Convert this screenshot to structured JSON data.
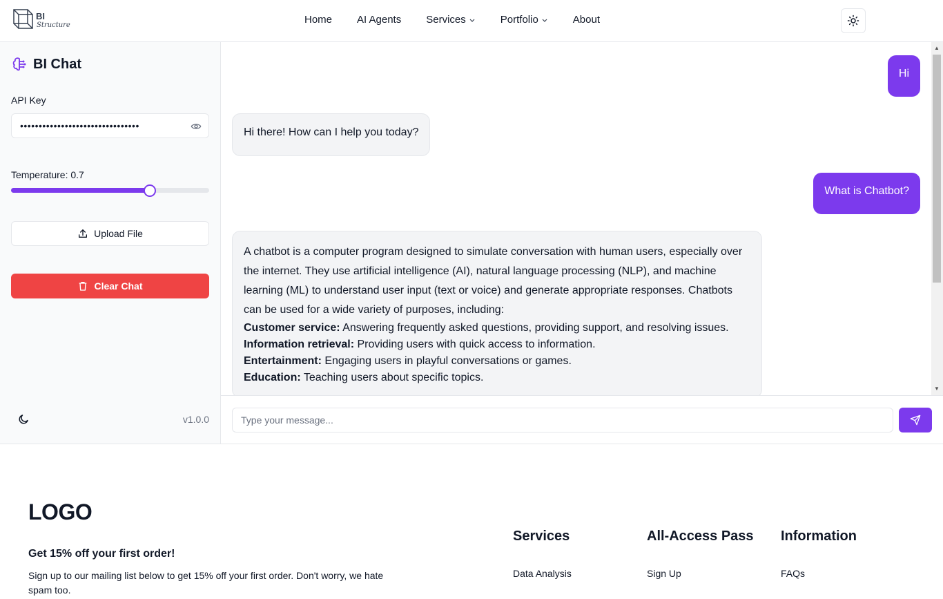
{
  "nav": {
    "logo_text_1": "BI",
    "logo_text_2": "Structure",
    "links": [
      {
        "label": "Home",
        "dropdown": false
      },
      {
        "label": "AI Agents",
        "dropdown": false
      },
      {
        "label": "Services",
        "dropdown": true
      },
      {
        "label": "Portfolio",
        "dropdown": true
      },
      {
        "label": "About",
        "dropdown": false
      }
    ],
    "theme_icon": "sun-icon"
  },
  "sidebar": {
    "title": "BI Chat",
    "title_icon": "brain-icon",
    "api_key_label": "API Key",
    "api_key_value": "••••••••••••••••••••••••••••••••",
    "temperature_label": "Temperature: 0.7",
    "temperature_value": 0.7,
    "upload_label": "Upload File",
    "clear_label": "Clear Chat",
    "version": "v1.0.0",
    "accent_color": "#7c3aed",
    "danger_color": "#ef4444"
  },
  "chat": {
    "messages": [
      {
        "role": "user",
        "text": "Hi"
      },
      {
        "role": "bot",
        "text": "Hi there! How can I help you today?"
      },
      {
        "role": "user",
        "text": "What is Chatbot?"
      },
      {
        "role": "bot",
        "intro": "A chatbot is a computer program designed to simulate conversation with human users, especially over the internet. They use artificial intelligence (AI), natural language processing (NLP), and machine learning (ML) to understand user input (text or voice) and generate appropriate responses. Chatbots can be used for a wide variety of purposes, including:",
        "items": [
          {
            "term": "Customer service:",
            "desc": " Answering frequently asked questions, providing support, and resolving issues."
          },
          {
            "term": "Information retrieval:",
            "desc": " Providing users with quick access to information."
          },
          {
            "term": "Entertainment:",
            "desc": " Engaging users in playful conversations or games."
          },
          {
            "term": "Education:",
            "desc": " Teaching users about specific topics."
          }
        ]
      }
    ],
    "input_placeholder": "Type your message..."
  },
  "footer": {
    "logo": "LOGO",
    "offer_title": "Get 15% off your first order!",
    "offer_desc": "Sign up to our mailing list below to get 15% off your first order. Don't worry, we hate spam too.",
    "columns": [
      {
        "title": "Services",
        "item": "Data Analysis"
      },
      {
        "title": "All-Access Pass",
        "item": "Sign Up"
      },
      {
        "title": "Information",
        "item": "FAQs"
      }
    ]
  }
}
